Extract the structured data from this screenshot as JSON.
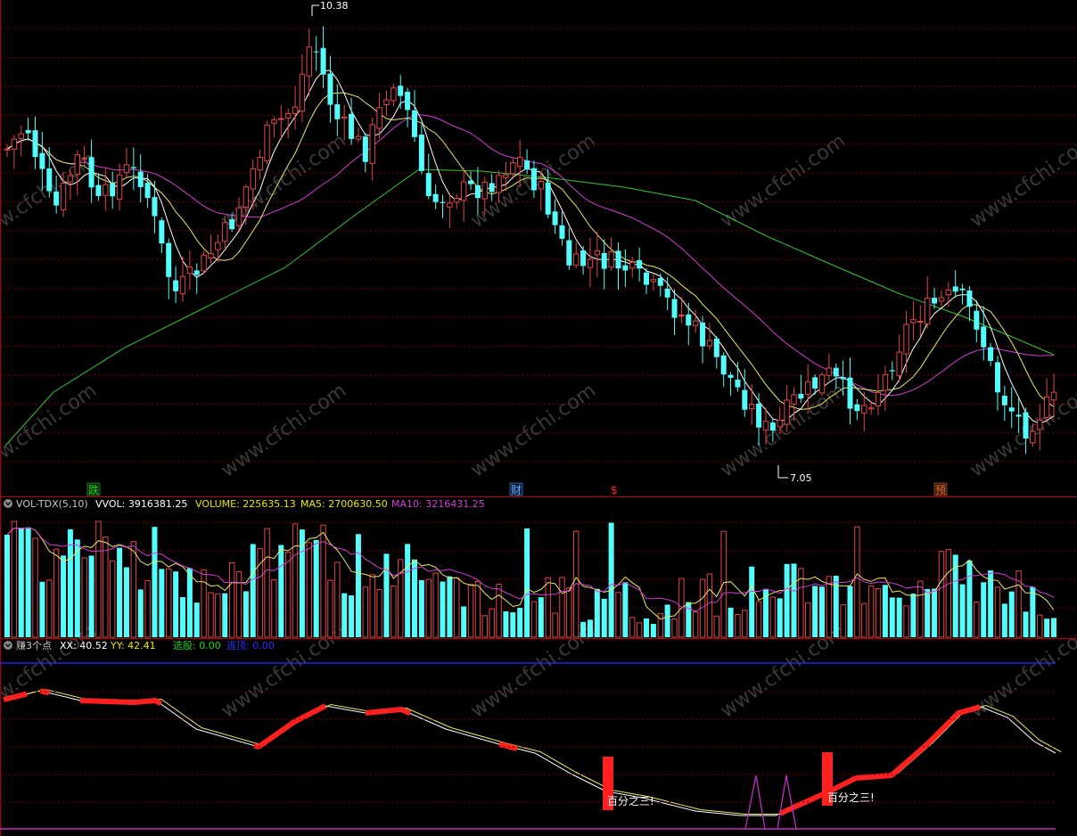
{
  "colors": {
    "background": "#000000",
    "grid": "#7a0000",
    "border": "#b40000",
    "bull": "#e04848",
    "bear": "#54fcfc",
    "ma_yellow": "#e8e86a",
    "ma_white": "#ffffff",
    "ma_magenta": "#d040d0",
    "ma_green": "#34c434",
    "blue_line": "#2c2cff",
    "purple": "#c030c0",
    "signal_red": "#ff2020",
    "text_yellow": "#e8e800",
    "text_green": "#20d020",
    "text_blue": "#3030ff"
  },
  "main_chart": {
    "high_label": "10.38",
    "low_label": "7.05",
    "events": [
      {
        "label": "跌",
        "color": "#20d020"
      },
      {
        "label": "财",
        "color": "#6ab0ff"
      },
      {
        "label": "$",
        "color": "#ff3030"
      },
      {
        "label": "预",
        "color": "#e07030"
      }
    ]
  },
  "volume_panel": {
    "icon": "chevron-down-icon",
    "title": "VOL-TDX(5,10)",
    "vvol_label": "VVOL: 3916381.25",
    "volume_label": "VOLUME: 225635.13",
    "ma5_label": "MA5: 2700630.50",
    "ma10_label": "MA10: 3216431.25"
  },
  "indicator_panel": {
    "icon": "chevron-down-icon",
    "title": "赚3个点",
    "xx_label": "XX: 40.52",
    "yy_label": "YY: 42.41",
    "select_label": "选股: 0.00",
    "exit_label": "逃顶: 0.00",
    "annotation_1": "百分之三!",
    "annotation_2": "百分之三!"
  },
  "watermark": "www.cfchi.com"
}
